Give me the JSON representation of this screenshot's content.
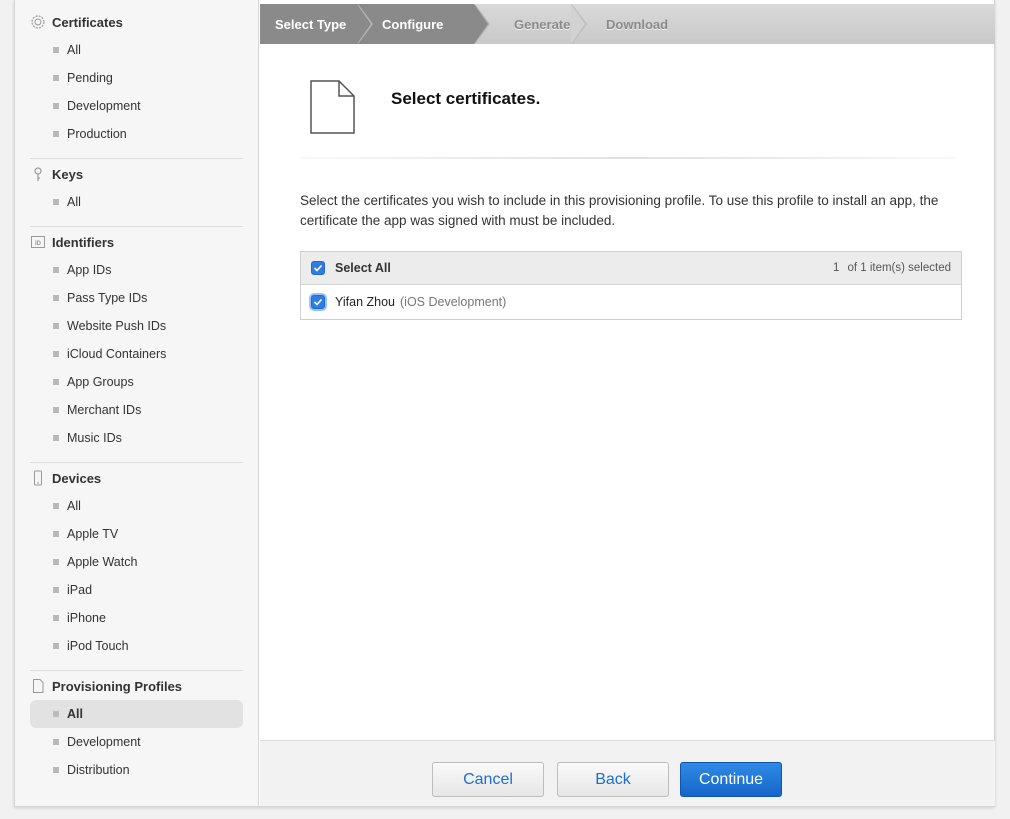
{
  "sidebar": {
    "groups": [
      {
        "title": "Certificates",
        "icon": "gear-badge-icon",
        "items": [
          "All",
          "Pending",
          "Development",
          "Production"
        ]
      },
      {
        "title": "Keys",
        "icon": "key-icon",
        "items": [
          "All"
        ]
      },
      {
        "title": "Identifiers",
        "icon": "id-icon",
        "items": [
          "App IDs",
          "Pass Type IDs",
          "Website Push IDs",
          "iCloud Containers",
          "App Groups",
          "Merchant IDs",
          "Music IDs"
        ]
      },
      {
        "title": "Devices",
        "icon": "device-icon",
        "items": [
          "All",
          "Apple TV",
          "Apple Watch",
          "iPad",
          "iPhone",
          "iPod Touch"
        ]
      },
      {
        "title": "Provisioning Profiles",
        "icon": "document-icon",
        "items": [
          "All",
          "Development",
          "Distribution"
        ],
        "active_item": "All"
      }
    ]
  },
  "steps": [
    "Select Type",
    "Configure",
    "Generate",
    "Download"
  ],
  "current_step": "Configure",
  "main": {
    "title": "Select certificates.",
    "description": "Select the certificates you wish to include in this provisioning profile. To use this profile to install an app, the certificate the app was signed with must be included.",
    "select_all_label": "Select All",
    "selected_count": "1",
    "count_text": "of 1 item(s) selected",
    "certificates": [
      {
        "name": "Yifan Zhou",
        "type": "(iOS Development)",
        "checked": true
      }
    ]
  },
  "footer": {
    "cancel": "Cancel",
    "back": "Back",
    "continue": "Continue"
  },
  "colors": {
    "accent": "#2f7de1",
    "step_active": "#8a8a8a"
  }
}
